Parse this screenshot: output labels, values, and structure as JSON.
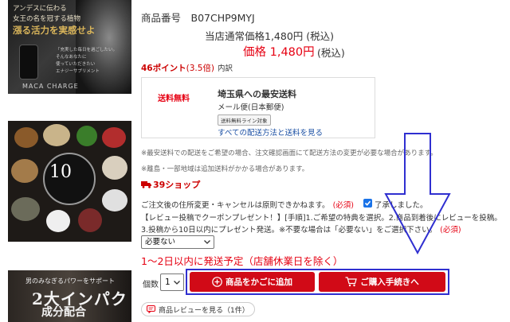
{
  "product": {
    "sku_line": "商品番号　B07CHP9MYJ",
    "regular_price": "当店通常価格1,480円 (税込)",
    "price_label": "価格 1,480円",
    "price_tax": "(税込)"
  },
  "points": {
    "amount": "46ポイント",
    "rate": "(3.5倍)",
    "breakdown_link": "内訳"
  },
  "shipping": {
    "free_label": "送料無料",
    "title": "埼玉県への最安送料",
    "method": "メール便(日本郵便)",
    "line_tag": "送料無料ライン対象",
    "all_methods_link": "すべての配送方法と送料を見る"
  },
  "notes": {
    "line1": "※最安送料での配送をご希望の場合、注文確認画面にて配送方法の変更が必要な場合があります。",
    "line2": "※離島・一部地域は追加送料がかかる場合があります。"
  },
  "shop_badge": "39ショップ",
  "options": {
    "change_notice": "ご注文後の住所変更・キャンセルは原則できかねます。",
    "required": "(必須)",
    "agree_text": "了承しました。",
    "agree_checked": true,
    "review_line1": "【レビュー投稿でクーポンプレゼント！】[手順]1.ご希望の特典を選択。2.商品到着後にレビューを投稿。",
    "review_line2": "3.投稿から10日以内にプレゼント発送。※不要な場合は「必要ない」をご選択下さい。",
    "review_required": "(必須)",
    "review_select_value": "必要ない"
  },
  "delivery_estimate": "1〜2日以内に発送予定（店舗休業日を除く）",
  "purchase": {
    "qty_label": "個数",
    "qty_value": "1",
    "add_to_cart": "商品をかごに追加",
    "checkout": "ご購入手続きへ"
  },
  "review_button": "商品レビューを見る（1件）",
  "thumbnails": {
    "t1_line1": "アンデスに伝わる",
    "t1_line2": "女王の名を冠する植物",
    "t1_big": "漲る活力を実感せよ",
    "t1_small1": "「充実した毎日を過ごしたい。",
    "t1_small2": "そんなあなたに",
    "t1_small3": "使っていただきたい",
    "t1_small4": "エナジーサプリメント",
    "t1_brand": "MACA CHARGE",
    "t2_number": "10",
    "t3_sub": "男のみなぎるパワーをサポート",
    "t3_big": "2大インパクト",
    "t3_big2": "成分配合"
  },
  "colors": {
    "price_red": "#e60012",
    "button_red": "#d10a17",
    "link_blue": "#1a4fa3",
    "annotation_blue": "#2f2fd0"
  }
}
